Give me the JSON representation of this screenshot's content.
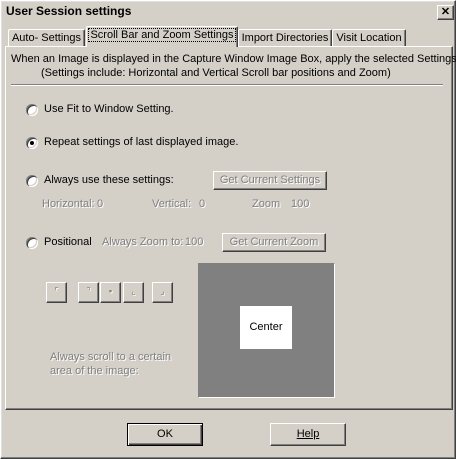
{
  "window": {
    "title": "User Session settings",
    "close_glyph": "✕"
  },
  "tabs": [
    {
      "label": "Auto- Settings",
      "active": false
    },
    {
      "label": "Scroll Bar and Zoom Settings",
      "active": true
    },
    {
      "label": "Import Directories",
      "active": false
    },
    {
      "label": "Visit Location",
      "active": false
    }
  ],
  "description": {
    "line1": "When an Image is displayed in the Capture Window Image Box, apply the selected Settings",
    "line2": "(Settings include: Horizontal and Vertical Scroll bar positions and Zoom)"
  },
  "options": {
    "fit_window": {
      "label": "Use Fit to Window Setting.",
      "checked": false
    },
    "repeat_last": {
      "label": "Repeat settings of last displayed image.",
      "checked": true
    },
    "always_use": {
      "label": "Always use these settings:",
      "checked": false,
      "button": "Get Current Settings"
    },
    "positional": {
      "label": "Positional",
      "checked": false,
      "zoom_label": "Always Zoom to:",
      "zoom_value": "100",
      "button": "Get Current Zoom"
    }
  },
  "settings_values": {
    "horizontal_label": "Horizontal:",
    "horizontal_value": "0",
    "vertical_label": "Vertical:",
    "vertical_value": "0",
    "zoom_label": "Zoom",
    "zoom_value": "100"
  },
  "position_buttons": [
    "⌜",
    "⌝",
    "▪",
    "⌞",
    "⌟"
  ],
  "scroll_hint": {
    "line1": "Always scroll to a certain",
    "line2": "area of the image:"
  },
  "preview": {
    "center_label": "Center"
  },
  "footer": {
    "ok": "OK",
    "help": "Help"
  },
  "colors": {
    "face": "#d4d0c8",
    "preview_bg": "#808080",
    "disabled_text": "#808080"
  }
}
